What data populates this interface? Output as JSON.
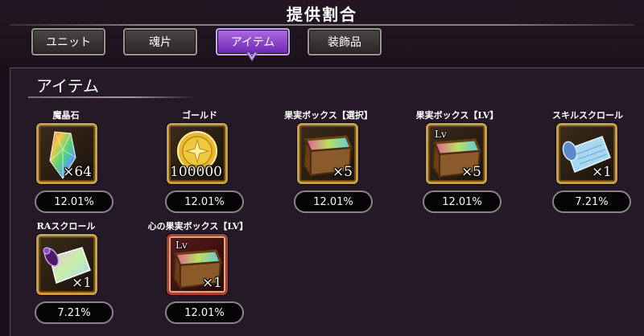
{
  "header": {
    "title": "提供割合"
  },
  "tabs": [
    {
      "label": "ユニット",
      "active": false
    },
    {
      "label": "魂片",
      "active": false
    },
    {
      "label": "アイテム",
      "active": true
    },
    {
      "label": "装飾品",
      "active": false
    }
  ],
  "section": {
    "title": "アイテム"
  },
  "items": [
    {
      "name": "魔晶石",
      "quantity": "×64",
      "rate": "12.01%",
      "icon": "crystal-icon"
    },
    {
      "name": "ゴールド",
      "quantity": "×100000",
      "rate": "12.01%",
      "icon": "gold-coin-icon"
    },
    {
      "name": "果実ボックス【選択】",
      "quantity": "×5",
      "rate": "12.01%",
      "icon": "fruit-box-icon"
    },
    {
      "name": "果実ボックス【LV】",
      "quantity": "×5",
      "rate": "12.01%",
      "icon": "fruit-box-lv-icon",
      "badge": "Lv"
    },
    {
      "name": "スキルスクロール",
      "quantity": "×1",
      "rate": "7.21%",
      "icon": "skill-scroll-icon"
    },
    {
      "name": "RAスクロール",
      "quantity": "×1",
      "rate": "7.21%",
      "icon": "ra-scroll-icon"
    },
    {
      "name": "心の果実ボックス【LV】",
      "quantity": "×1",
      "rate": "12.01%",
      "icon": "heart-fruit-box-icon",
      "badge": "Lv"
    }
  ],
  "colors": {
    "active_tab": "#8a3ad0",
    "gold_frame": "#c8a046",
    "red_frame": "#a84040"
  }
}
